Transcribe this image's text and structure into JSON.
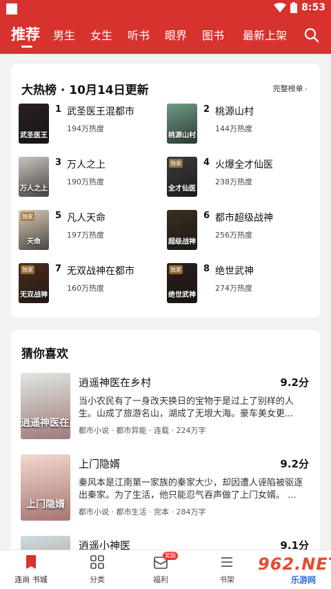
{
  "status_bar": {
    "time": "8:53"
  },
  "nav": {
    "tabs": [
      {
        "label": "推荐",
        "active": true
      },
      {
        "label": "男生"
      },
      {
        "label": "女生"
      },
      {
        "label": "听书"
      },
      {
        "label": "眼界"
      },
      {
        "label": "图书"
      },
      {
        "label": "最新上架"
      }
    ],
    "search_icon": "search-icon"
  },
  "hot_list": {
    "title": "大热榜 · 10月14日更新",
    "full_list_label": "完整榜单",
    "items": [
      {
        "rank": "1",
        "title": "武圣医王混都市",
        "heat": "194万热度",
        "cover_text": "武圣医王",
        "cover_color": "#2a2020"
      },
      {
        "rank": "2",
        "title": "桃源山村",
        "heat": "144万热度",
        "cover_text": "桃源山村",
        "cover_color": "#6f9c86"
      },
      {
        "rank": "3",
        "title": "万人之上",
        "heat": "190万热度",
        "cover_text": "万人之上",
        "cover_color": "#c9c3bd"
      },
      {
        "rank": "4",
        "title": "火爆全才仙医",
        "heat": "238万热度",
        "cover_text": "全才仙医",
        "cover_color": "#3b3a3c",
        "cover_tag": "独家"
      },
      {
        "rank": "5",
        "title": "凡人天命",
        "heat": "197万热度",
        "cover_text": "天命",
        "cover_color": "#d8cbb8",
        "cover_tag": "独家"
      },
      {
        "rank": "6",
        "title": "都市超级战神",
        "heat": "256万热度",
        "cover_text": "超级战神",
        "cover_color": "#3a2e22"
      },
      {
        "rank": "7",
        "title": "无双战神在都市",
        "heat": "160万热度",
        "cover_text": "无双战神",
        "cover_color": "#4b2d1c",
        "cover_tag": "独家"
      },
      {
        "rank": "8",
        "title": "绝世武神",
        "heat": "274万热度",
        "cover_text": "绝世武神",
        "cover_color": "#2b1f1a",
        "cover_tag": "独家"
      }
    ]
  },
  "guess": {
    "title": "猜你喜欢",
    "books": [
      {
        "title": "逍遥神医在乡村",
        "score": "9.2分",
        "desc": "当小农民有了一身改天换日的宝物于是过上了别样的人生。山成了旅游名山，湖成了无垠大海。豪车美女更...",
        "meta": "都市小说 · 都市异能 · 连载 · 224万字",
        "cover_text": "逍遥神医在乡村",
        "cover_color": "#dfe6e1"
      },
      {
        "title": "上门隐婿",
        "score": "9.2分",
        "desc": "秦风本是江南第一家族的秦家大少，却因遭人诬陷被驱逐出秦家。为了生活，他只能忍气吞声做了上门女婿。 ...",
        "meta": "都市小说 · 都市生活 · 完本 · 284万字",
        "cover_text": "上门隐婿",
        "cover_color": "#f1d9cf"
      },
      {
        "title": "逍遥小神医",
        "score": "9.1分",
        "cover_color": "#cfdde0"
      }
    ]
  },
  "bottom_bar": {
    "items": [
      {
        "label": "连尚 书城",
        "icon": "bookstore-icon",
        "active": true
      },
      {
        "label": "分类",
        "icon": "category-icon"
      },
      {
        "label": "福利",
        "icon": "gift-icon",
        "badge": "奖励"
      },
      {
        "label": "书架",
        "icon": "bookshelf-icon"
      }
    ]
  },
  "watermark": {
    "big": "962.NET",
    "small": "乐游网"
  },
  "colors": {
    "brand": "#d8322f",
    "background": "#f2f2f2"
  }
}
